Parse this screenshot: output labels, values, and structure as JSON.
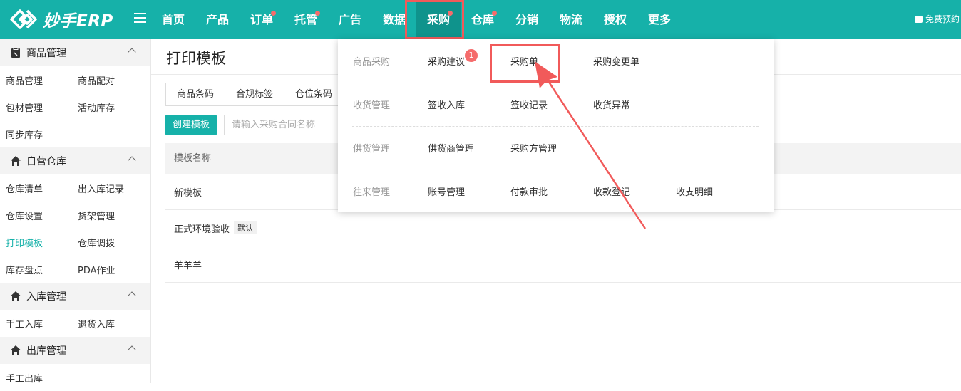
{
  "app": {
    "logo_text": "妙手ERP",
    "top_right_text": "免费预约"
  },
  "colors": {
    "brand": "#16b1a9",
    "brand_dark": "#0f938c",
    "highlight": "#f15a5a",
    "badge": "#f56c6c"
  },
  "nav": {
    "items": [
      {
        "label": "首页",
        "dot": false
      },
      {
        "label": "产品",
        "dot": false
      },
      {
        "label": "订单",
        "dot": true
      },
      {
        "label": "托管",
        "dot": true
      },
      {
        "label": "广告",
        "dot": false
      },
      {
        "label": "数据",
        "dot": false
      },
      {
        "label": "采购",
        "dot": true,
        "active": true
      },
      {
        "label": "仓库",
        "dot": true
      },
      {
        "label": "分销",
        "dot": false
      },
      {
        "label": "物流",
        "dot": false
      },
      {
        "label": "授权",
        "dot": false
      },
      {
        "label": "更多",
        "dot": false
      }
    ]
  },
  "sidebar": {
    "groups": [
      {
        "title": "商品管理",
        "icon": "clipboard-icon",
        "rows": [
          [
            "商品管理",
            "商品配对"
          ],
          [
            "包材管理",
            "活动库存"
          ],
          [
            "同步库存",
            ""
          ]
        ]
      },
      {
        "title": "自营仓库",
        "icon": "house-icon",
        "rows": [
          [
            "仓库清单",
            "出入库记录"
          ],
          [
            "仓库设置",
            "货架管理"
          ],
          [
            "打印模板",
            "仓库调拨"
          ],
          [
            "库存盘点",
            "PDA作业"
          ]
        ]
      },
      {
        "title": "入库管理",
        "icon": "house-icon",
        "rows": [
          [
            "手工入库",
            "退货入库"
          ]
        ]
      },
      {
        "title": "出库管理",
        "icon": "house-icon",
        "rows": [
          [
            "手工出库",
            ""
          ]
        ]
      }
    ],
    "active_item": "打印模板"
  },
  "main": {
    "title": "打印模板",
    "tabs": [
      "商品条码",
      "合规标签",
      "仓位条码"
    ],
    "create_button": "创建模板",
    "search_placeholder": "请输入采购合同名称",
    "table": {
      "header": "模板名称",
      "rows": [
        "新模板",
        "正式环境验收",
        "羊羊羊"
      ],
      "default_tag": "默认"
    }
  },
  "dropdown": {
    "sections": [
      {
        "category": "商品采购",
        "items": [
          "采购建议",
          "采购单",
          "采购变更单"
        ]
      },
      {
        "category": "收货管理",
        "items": [
          "签收入库",
          "签收记录",
          "收货异常"
        ]
      },
      {
        "category": "供货管理",
        "items": [
          "供货商管理",
          "采购方管理"
        ]
      },
      {
        "category": "往来管理",
        "items": [
          "账号管理",
          "付款审批",
          "收款登记",
          "收支明细"
        ]
      }
    ],
    "badge_count": "1"
  }
}
